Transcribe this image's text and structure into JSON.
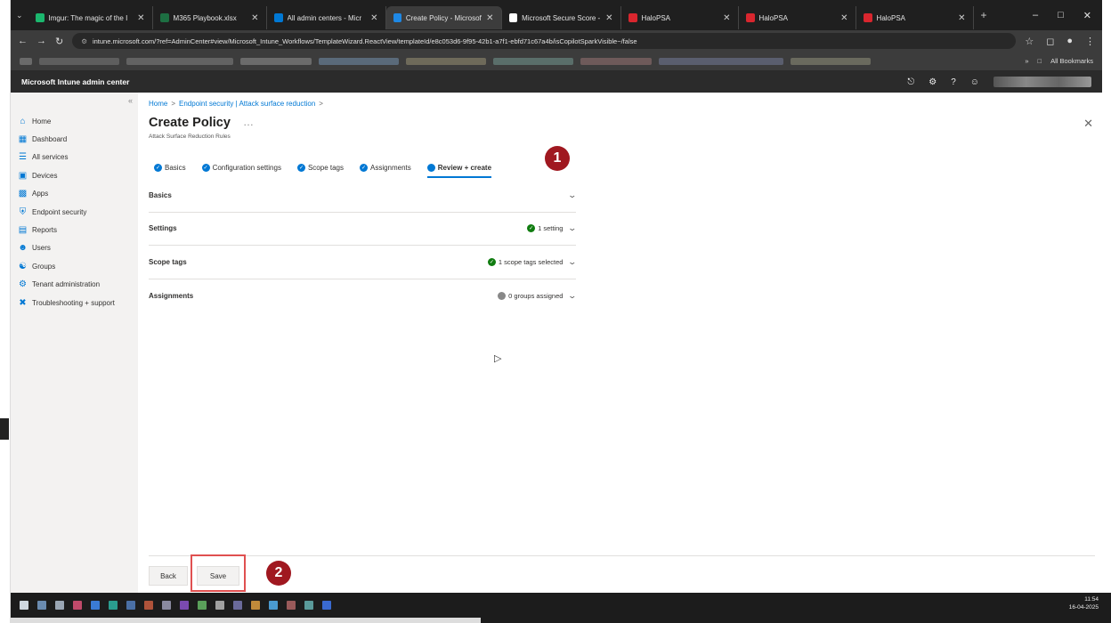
{
  "browser": {
    "tabs": [
      {
        "title": "Imgur: The magic of the I",
        "color": "#1bb76e",
        "active": false
      },
      {
        "title": "M365 Playbook.xlsx",
        "color": "#1d6f42",
        "active": false
      },
      {
        "title": "All admin centers - Micr",
        "color": "#0078d4",
        "active": false
      },
      {
        "title": "Create Policy - Microsoft I",
        "color": "#1e88e5",
        "active": true
      },
      {
        "title": "Microsoft Secure Score - I",
        "color": "#ffffff",
        "active": false
      },
      {
        "title": "HaloPSA",
        "color": "#d9262e",
        "active": false
      },
      {
        "title": "HaloPSA",
        "color": "#d9262e",
        "active": false
      },
      {
        "title": "HaloPSA",
        "color": "#d9262e",
        "active": false
      }
    ],
    "url": "intune.microsoft.com/?ref=AdminCenter#view/Microsoft_Intune_Workflows/TemplateWizard.ReactView/templateId/e8c053d6-9f95-42b1-a7f1-ebfd71c67a4b/isCopilotSparkVisible~/false",
    "all_bookmarks": "All Bookmarks"
  },
  "app": {
    "title": "Microsoft Intune admin center"
  },
  "sidebar": {
    "items": [
      {
        "label": "Home",
        "icon": "home-icon"
      },
      {
        "label": "Dashboard",
        "icon": "dashboard-icon"
      },
      {
        "label": "All services",
        "icon": "list-icon"
      },
      {
        "label": "Devices",
        "icon": "devices-icon"
      },
      {
        "label": "Apps",
        "icon": "apps-icon"
      },
      {
        "label": "Endpoint security",
        "icon": "shield-icon"
      },
      {
        "label": "Reports",
        "icon": "reports-icon"
      },
      {
        "label": "Users",
        "icon": "user-icon"
      },
      {
        "label": "Groups",
        "icon": "groups-icon"
      },
      {
        "label": "Tenant administration",
        "icon": "tenant-icon"
      },
      {
        "label": "Troubleshooting + support",
        "icon": "wrench-icon"
      }
    ]
  },
  "breadcrumb": {
    "home": "Home",
    "endpoint": "Endpoint security | Attack surface reduction"
  },
  "page": {
    "title": "Create Policy",
    "more": "…",
    "subtitle": "Attack Surface Reduction Rules"
  },
  "steps": [
    {
      "label": "Basics",
      "state": "done"
    },
    {
      "label": "Configuration settings",
      "state": "done"
    },
    {
      "label": "Scope tags",
      "state": "done"
    },
    {
      "label": "Assignments",
      "state": "done"
    },
    {
      "label": "Review + create",
      "state": "current"
    }
  ],
  "sections": {
    "basics": {
      "label": "Basics"
    },
    "settings": {
      "label": "Settings",
      "status": "1 setting"
    },
    "scope": {
      "label": "Scope tags",
      "status": "1 scope tags selected"
    },
    "assignments": {
      "label": "Assignments",
      "status": "0 groups assigned"
    }
  },
  "buttons": {
    "back": "Back",
    "save": "Save"
  },
  "callouts": {
    "one": "1",
    "two": "2"
  },
  "tray": {
    "time": "11:54",
    "date": "16-04-2025"
  }
}
